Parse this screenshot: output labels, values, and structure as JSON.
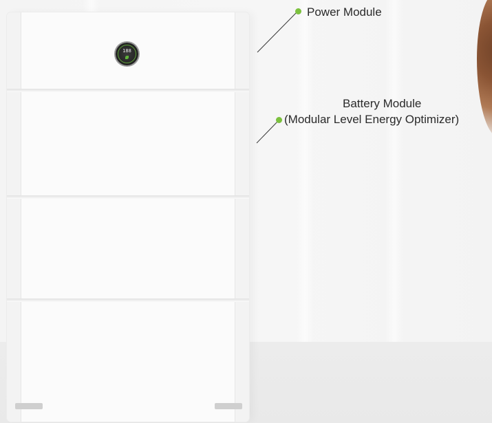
{
  "callouts": {
    "power_module": "Power Module",
    "battery_module_line1": "Battery Module",
    "battery_module_line2": "(Modular Level Energy Optimizer)"
  },
  "display": {
    "reading": "188"
  },
  "colors": {
    "accent_dot": "#7cc13e",
    "unit_body": "#fbfbfb",
    "background": "#f4f4f4"
  }
}
